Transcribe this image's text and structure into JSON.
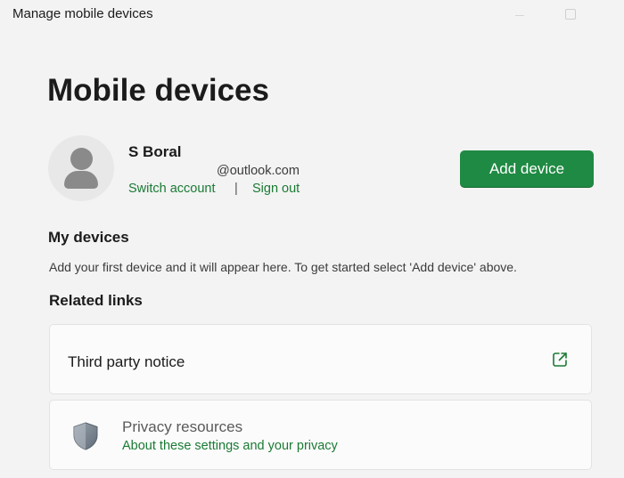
{
  "window": {
    "title": "Manage mobile devices"
  },
  "page": {
    "title": "Mobile devices"
  },
  "account": {
    "name": "S Boral",
    "email": "@outlook.com",
    "switch_account_label": "Switch account",
    "separator": "|",
    "sign_out_label": "Sign out"
  },
  "actions": {
    "add_device_label": "Add device"
  },
  "my_devices": {
    "heading": "My devices",
    "empty_hint": "Add your first device and it will appear here. To get started select 'Add device' above."
  },
  "related_links": {
    "heading": "Related links",
    "third_party": {
      "title": "Third party notice",
      "icon": "open-external-icon"
    },
    "privacy": {
      "title": "Privacy resources",
      "link": "About these settings and your privacy",
      "icon": "shield-icon"
    }
  },
  "colors": {
    "accent": "#1f8a43",
    "link": "#1a7a34",
    "background": "#f3f3f3",
    "card": "#fbfbfb"
  }
}
